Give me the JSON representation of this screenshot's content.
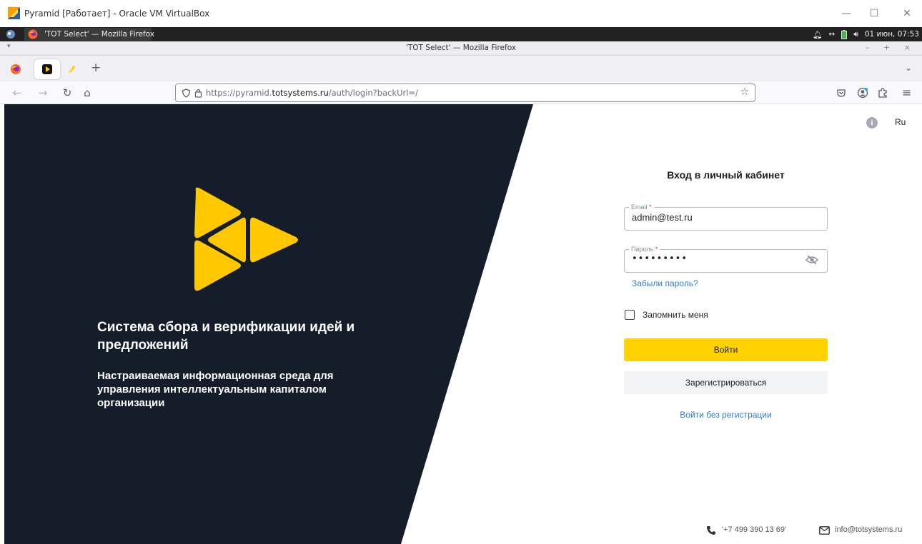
{
  "vbox": {
    "title": "Pyramid [Работает] - Oracle VM VirtualBox",
    "controls": {
      "minimize": "—",
      "maximize": "☐",
      "close": "✕"
    }
  },
  "os_panel": {
    "task_title": "'TOT Select' — Mozilla Firefox",
    "clock": "01 июн, 07:53"
  },
  "firefox": {
    "window_title": "'TOT Select' — Mozilla Firefox",
    "url_prefix": "https://pyramid.",
    "url_domain": "totsystems.ru",
    "url_path": "/auth/login?backUrl=/",
    "new_tab": "+"
  },
  "page": {
    "lang": "Ru",
    "headline": "Система сбора и верификации идей и предложений",
    "subline": "Настраиваемая информационная среда для управления интеллектуальным капиталом организации",
    "form_title": "Вход в личный кабинет",
    "email_label": "Email",
    "email_value": "admin@test.ru",
    "password_label": "Пароль",
    "password_value": "•••••••••",
    "required_mark": "*",
    "forgot": "Забыли пароль?",
    "remember": "Запомнить меня",
    "login": "Войти",
    "register": "Зарегистрироваться",
    "guest": "Войти без регистрации",
    "phone": "'+7 499 390 13 69'",
    "email_contact": "info@totsystems.ru"
  },
  "colors": {
    "dark_panel": "#151d2b",
    "accent_yellow": "#ffd200",
    "link_blue": "#2c7be5"
  }
}
